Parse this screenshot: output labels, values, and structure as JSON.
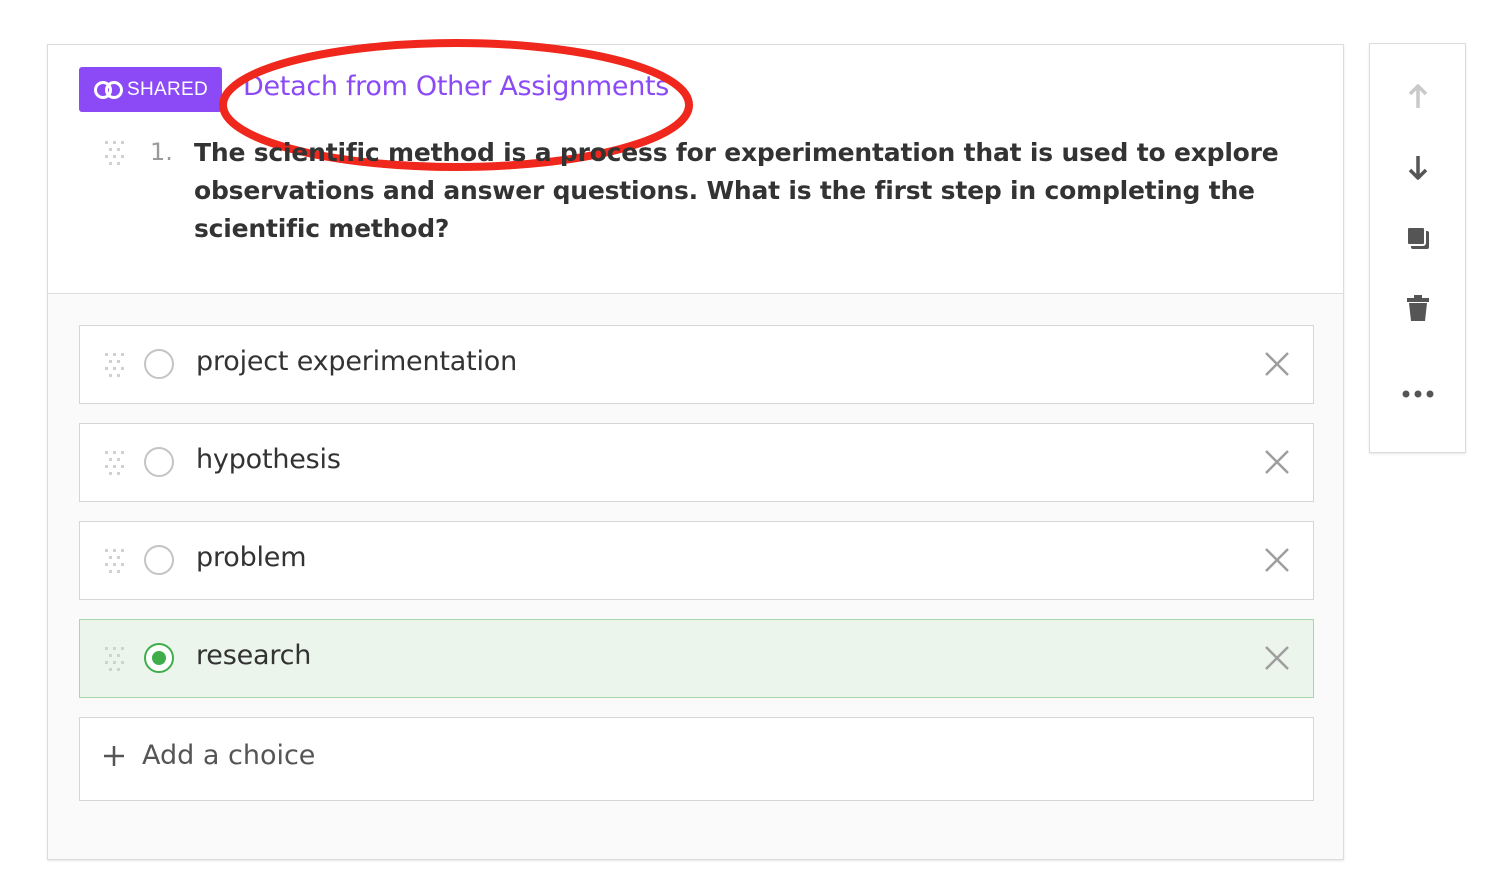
{
  "badge": {
    "icon": "link-rings-icon",
    "label": "SHARED"
  },
  "detach_link": "Detach from Other Assignments",
  "question": {
    "number": "1.",
    "text": "The scientific method is a process for experimentation that is used to explore observations and answer questions. What is the first step in completing the scientific method?"
  },
  "choices": [
    {
      "label": "project experimentation",
      "correct": false
    },
    {
      "label": "hypothesis",
      "correct": false
    },
    {
      "label": "problem",
      "correct": false
    },
    {
      "label": "research",
      "correct": true
    }
  ],
  "add_choice_label": "Add a choice",
  "toolbar": {
    "items": [
      "move-up-icon",
      "move-down-icon",
      "duplicate-icon",
      "trash-icon",
      "more-icon"
    ]
  },
  "colors": {
    "accent": "#8b4af6",
    "correct_green": "#3fae4a",
    "correct_bg": "#ebf5eb",
    "annotation_red": "#f0271c"
  }
}
